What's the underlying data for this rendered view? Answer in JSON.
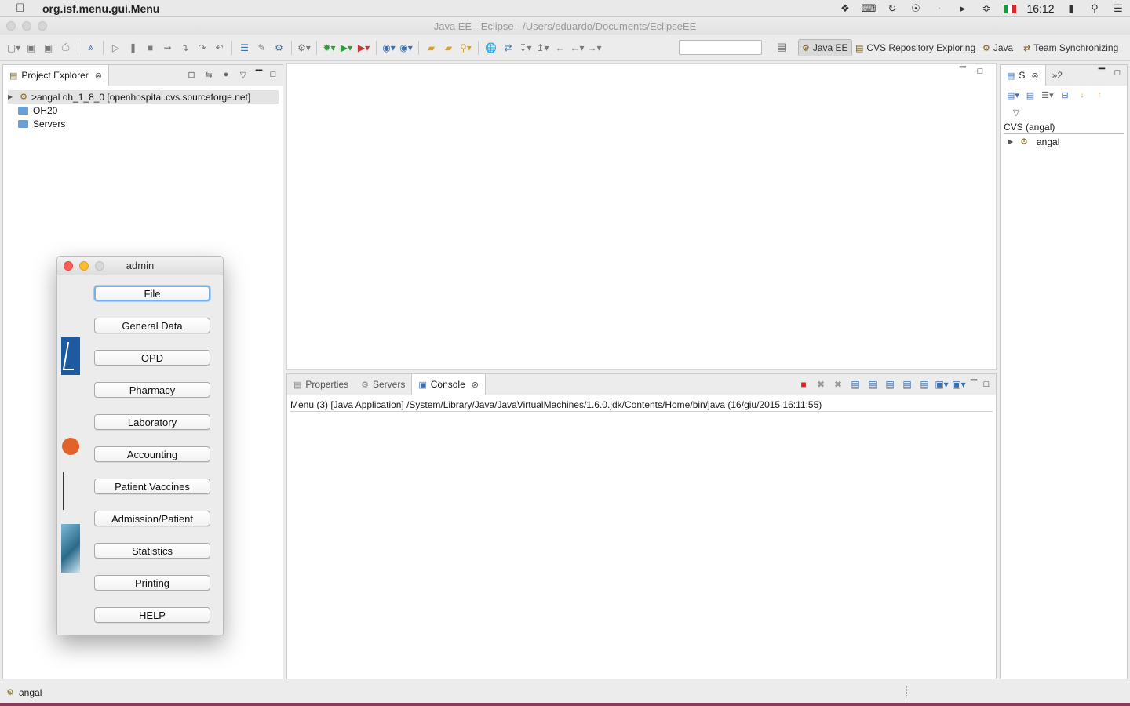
{
  "menubar": {
    "app_name": "org.isf.menu.gui.Menu",
    "clock": "16:12",
    "flag_colors": [
      "#1a9a3a",
      "#ffffff",
      "#d42a2a"
    ]
  },
  "window": {
    "title": "Java EE - Eclipse - /Users/eduardo/Documents/EclipseEE"
  },
  "perspectives": [
    {
      "label": "Java EE",
      "icon": "java-ee-perspective-icon",
      "active": true
    },
    {
      "label": "CVS Repository Exploring",
      "icon": "cvs-perspective-icon",
      "active": false
    },
    {
      "label": "Java",
      "icon": "java-perspective-icon",
      "active": false
    },
    {
      "label": "Team Synchronizing",
      "icon": "team-sync-perspective-icon",
      "active": false
    }
  ],
  "project_explorer": {
    "tab_label": "Project Explorer",
    "items": [
      {
        "label": ">angal  oh_1_8_0 [openhospital.cvs.sourceforge.net]"
      },
      {
        "label": "OH20"
      },
      {
        "label": "Servers"
      }
    ]
  },
  "bottom_panel": {
    "tabs": [
      {
        "label": "Properties"
      },
      {
        "label": "Servers"
      },
      {
        "label": "Console"
      }
    ],
    "console_line": "Menu (3) [Java Application] /System/Library/Java/JavaVirtualMachines/1.6.0.jdk/Contents/Home/bin/java (16/giu/2015 16:11:55)"
  },
  "right_panel": {
    "tab_label": "S",
    "overflow_label": "»2",
    "header": "CVS (angal)",
    "items": [
      {
        "label": "angal"
      }
    ]
  },
  "status": {
    "text": "angal"
  },
  "admin_window": {
    "title": "admin",
    "buttons": [
      "File",
      "General Data",
      "OPD",
      "Pharmacy",
      "Laboratory",
      "Accounting",
      "Patient Vaccines",
      "Admission/Patient",
      "Statistics",
      "Printing",
      "HELP"
    ]
  }
}
